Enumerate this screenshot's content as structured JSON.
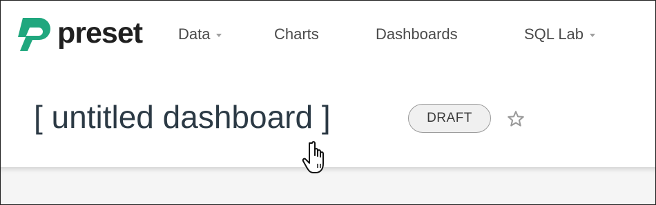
{
  "app": {
    "brand_name": "preset",
    "brand_color": "#20a77e"
  },
  "navbar": {
    "items": [
      {
        "label": "Data",
        "has_dropdown": true
      },
      {
        "label": "Charts",
        "has_dropdown": false
      },
      {
        "label": "Dashboards",
        "has_dropdown": false
      },
      {
        "label": "SQL Lab",
        "has_dropdown": true
      }
    ]
  },
  "dashboard": {
    "title": "[ untitled dashboard ]",
    "status_badge": "DRAFT",
    "favorite_icon": "star-outline-icon",
    "favorited": false
  },
  "pointer": {
    "icon": "hand-pointer-icon"
  }
}
